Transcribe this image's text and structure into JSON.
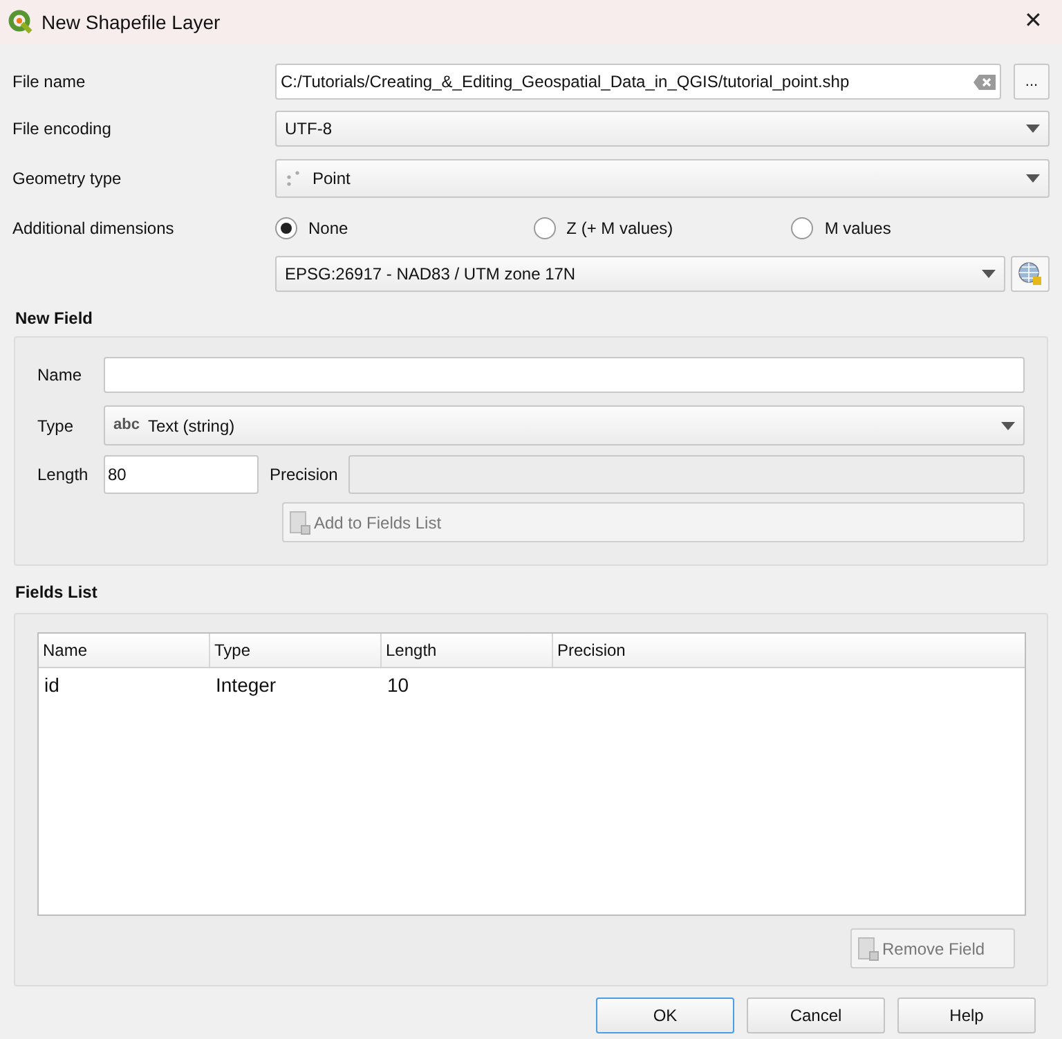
{
  "window": {
    "title": "New Shapefile Layer",
    "close": "✕"
  },
  "file_name": {
    "label": "File name",
    "value": "C:/Tutorials/Creating_&_Editing_Geospatial_Data_in_QGIS/tutorial_point.shp",
    "browse": "..."
  },
  "file_encoding": {
    "label": "File encoding",
    "value": "UTF-8"
  },
  "geometry_type": {
    "label": "Geometry type",
    "value": "Point"
  },
  "additional_dimensions": {
    "label": "Additional dimensions",
    "options": [
      {
        "label": "None",
        "selected": true
      },
      {
        "label": "Z (+ M values)",
        "selected": false
      },
      {
        "label": "M values",
        "selected": false
      }
    ]
  },
  "crs": {
    "value": "EPSG:26917 - NAD83 / UTM zone 17N"
  },
  "new_field": {
    "title": "New Field",
    "name_label": "Name",
    "type_label": "Type",
    "type_prefix": "abc",
    "type_value": "Text (string)",
    "length_label": "Length",
    "length_value": "80",
    "precision_label": "Precision",
    "precision_disabled": true,
    "add_button": {
      "label": "Add to Fields List",
      "disabled": true
    }
  },
  "fields_list": {
    "title": "Fields List",
    "columns": [
      "Name",
      "Type",
      "Length",
      "Precision"
    ],
    "rows": [
      [
        "id",
        "Integer",
        "10",
        null
      ]
    ],
    "remove_button": {
      "label": "Remove Field",
      "disabled": true
    }
  },
  "buttons": [
    {
      "label": "OK",
      "default": true
    },
    {
      "label": "Cancel",
      "default": false
    },
    {
      "label": "Help",
      "default": false
    }
  ]
}
